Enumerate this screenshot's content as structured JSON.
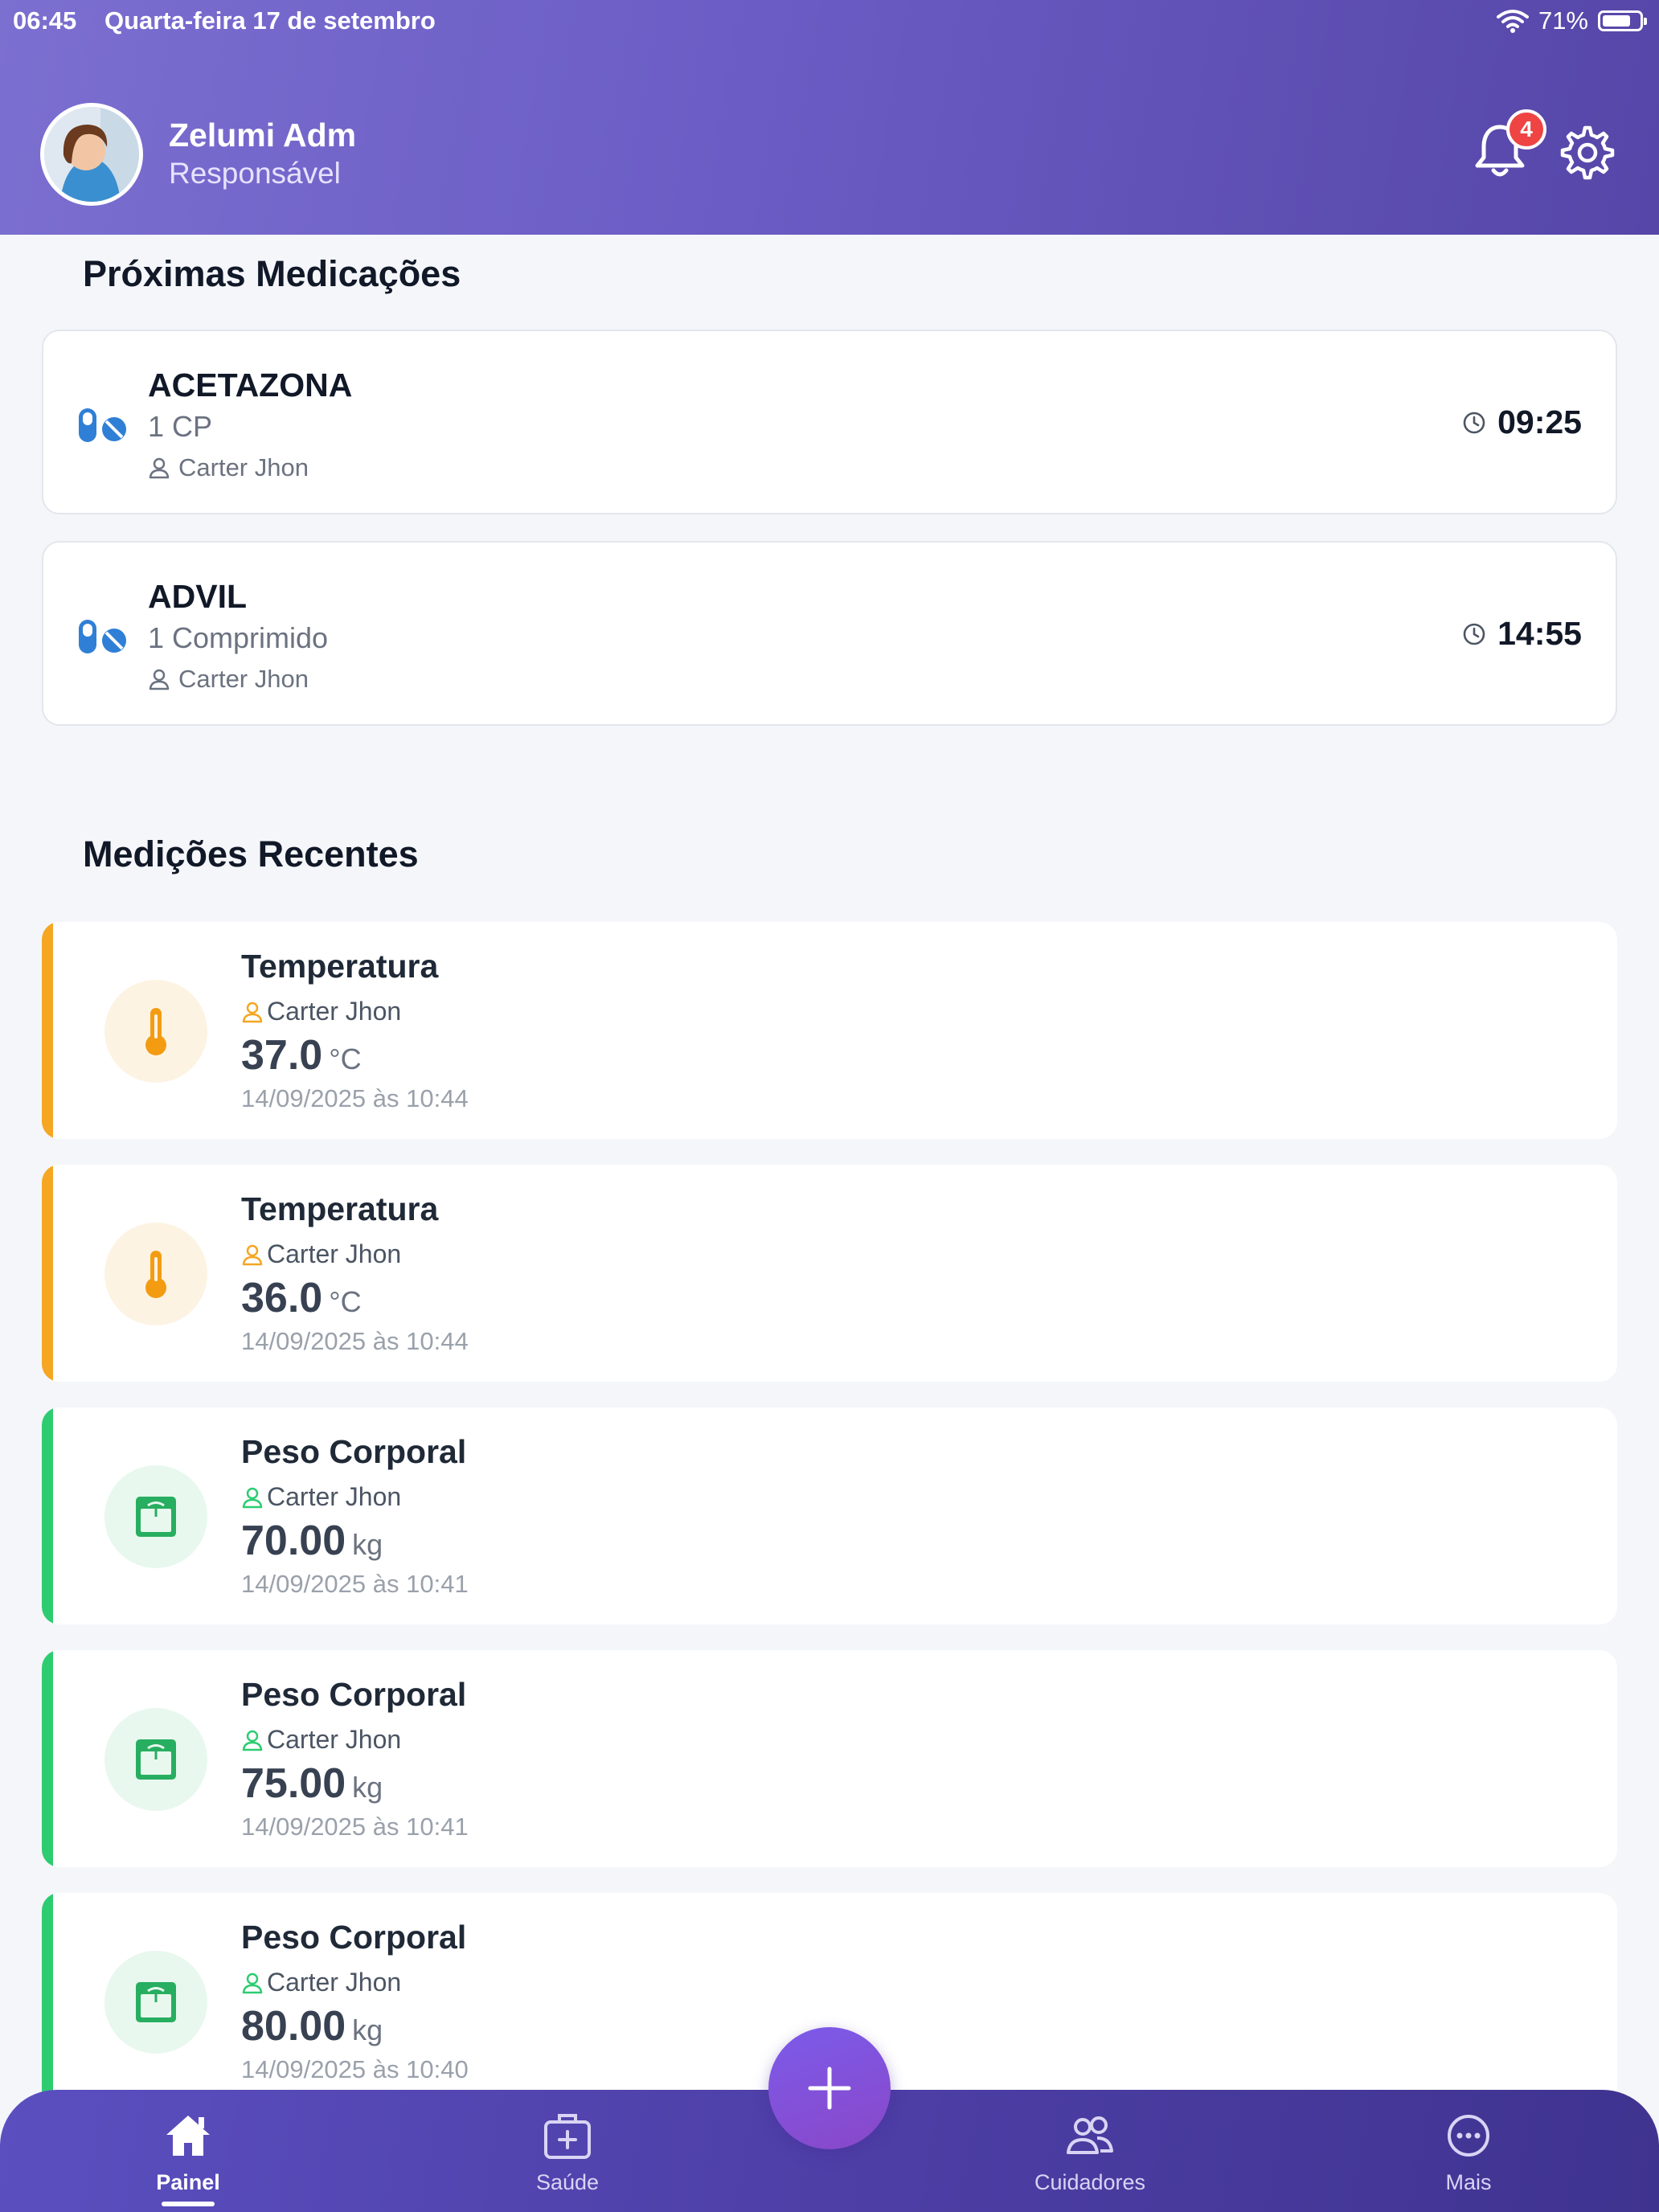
{
  "status_bar": {
    "time": "06:45",
    "date": "Quarta-feira 17 de setembro",
    "battery": "71%"
  },
  "header": {
    "user_name": "Zelumi Adm",
    "user_role": "Responsável",
    "notification_count": "4"
  },
  "medications": {
    "title": "Próximas Medicações",
    "items": [
      {
        "name": "ACETAZONA",
        "dose": "1 CP",
        "person": "Carter Jhon",
        "time": "09:25"
      },
      {
        "name": "ADVIL",
        "dose": "1 Comprimido",
        "person": "Carter Jhon",
        "time": "14:55"
      }
    ]
  },
  "measurements": {
    "title": "Medições Recentes",
    "items": [
      {
        "type": "Temperatura",
        "person": "Carter Jhon",
        "value": "37.0",
        "unit": "°C",
        "date": "14/09/2025 às 10:44"
      },
      {
        "type": "Temperatura",
        "person": "Carter Jhon",
        "value": "36.0",
        "unit": "°C",
        "date": "14/09/2025 às 10:44"
      },
      {
        "type": "Peso Corporal",
        "person": "Carter Jhon",
        "value": "70.00",
        "unit": "kg",
        "date": "14/09/2025 às 10:41"
      },
      {
        "type": "Peso Corporal",
        "person": "Carter Jhon",
        "value": "75.00",
        "unit": "kg",
        "date": "14/09/2025 às 10:41"
      },
      {
        "type": "Peso Corporal",
        "person": "Carter Jhon",
        "value": "80.00",
        "unit": "kg",
        "date": "14/09/2025 às 10:40"
      }
    ]
  },
  "nav": {
    "painel": "Painel",
    "saude": "Saúde",
    "cuidadores": "Cuidadores",
    "mais": "Mais"
  },
  "colors": {
    "header_gradient_start": "#7b6fd0",
    "header_gradient_end": "#5646a8",
    "temperature_accent": "#f5a623",
    "weight_accent": "#2ecc71",
    "pill_blue": "#2f7fd6",
    "badge_red": "#ef4444"
  },
  "icons": {
    "notification": "bell-icon",
    "settings": "gear-icon",
    "medication": "pill-icon",
    "clock": "clock-icon",
    "person": "person-icon",
    "temperature": "thermometer-icon",
    "weight": "scale-icon",
    "add": "plus-icon",
    "home": "home-icon",
    "health": "medical-kit-icon",
    "caregivers": "users-icon",
    "more": "more-icon"
  }
}
